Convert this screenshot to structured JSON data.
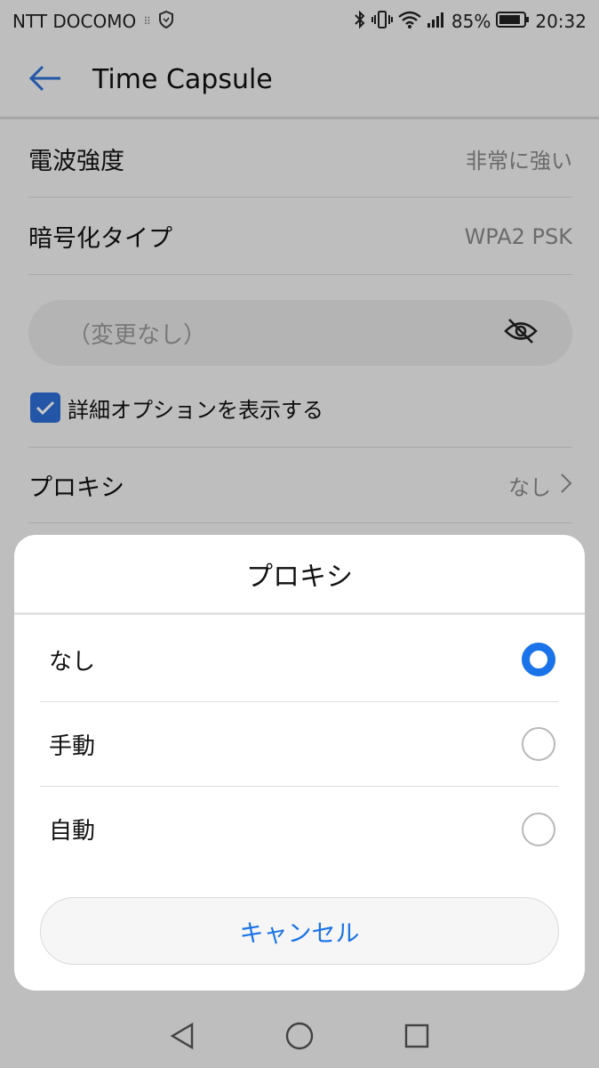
{
  "status_bar": {
    "carrier": "NTT DOCOMO",
    "battery": "85%",
    "time": "20:32"
  },
  "app_bar": {
    "title": "Time Capsule",
    "back_icon": "back-arrow-icon"
  },
  "details": {
    "signal": {
      "label": "電波強度",
      "value": "非常に強い"
    },
    "security": {
      "label": "暗号化タイプ",
      "value": "WPA2 PSK"
    },
    "password": {
      "placeholder": "（変更なし）",
      "icon": "eye-off-icon"
    },
    "advanced": {
      "label": "詳細オプションを表示する",
      "checked": true
    },
    "proxy": {
      "label": "プロキシ",
      "value": "なし"
    }
  },
  "dialog": {
    "title": "プロキシ",
    "options": [
      {
        "label": "なし",
        "selected": true
      },
      {
        "label": "手動",
        "selected": false
      },
      {
        "label": "自動",
        "selected": false
      }
    ],
    "cancel_label": "キャンセル"
  },
  "colors": {
    "accent": "#1a73e8",
    "checkbox": "#2f6fd8"
  }
}
